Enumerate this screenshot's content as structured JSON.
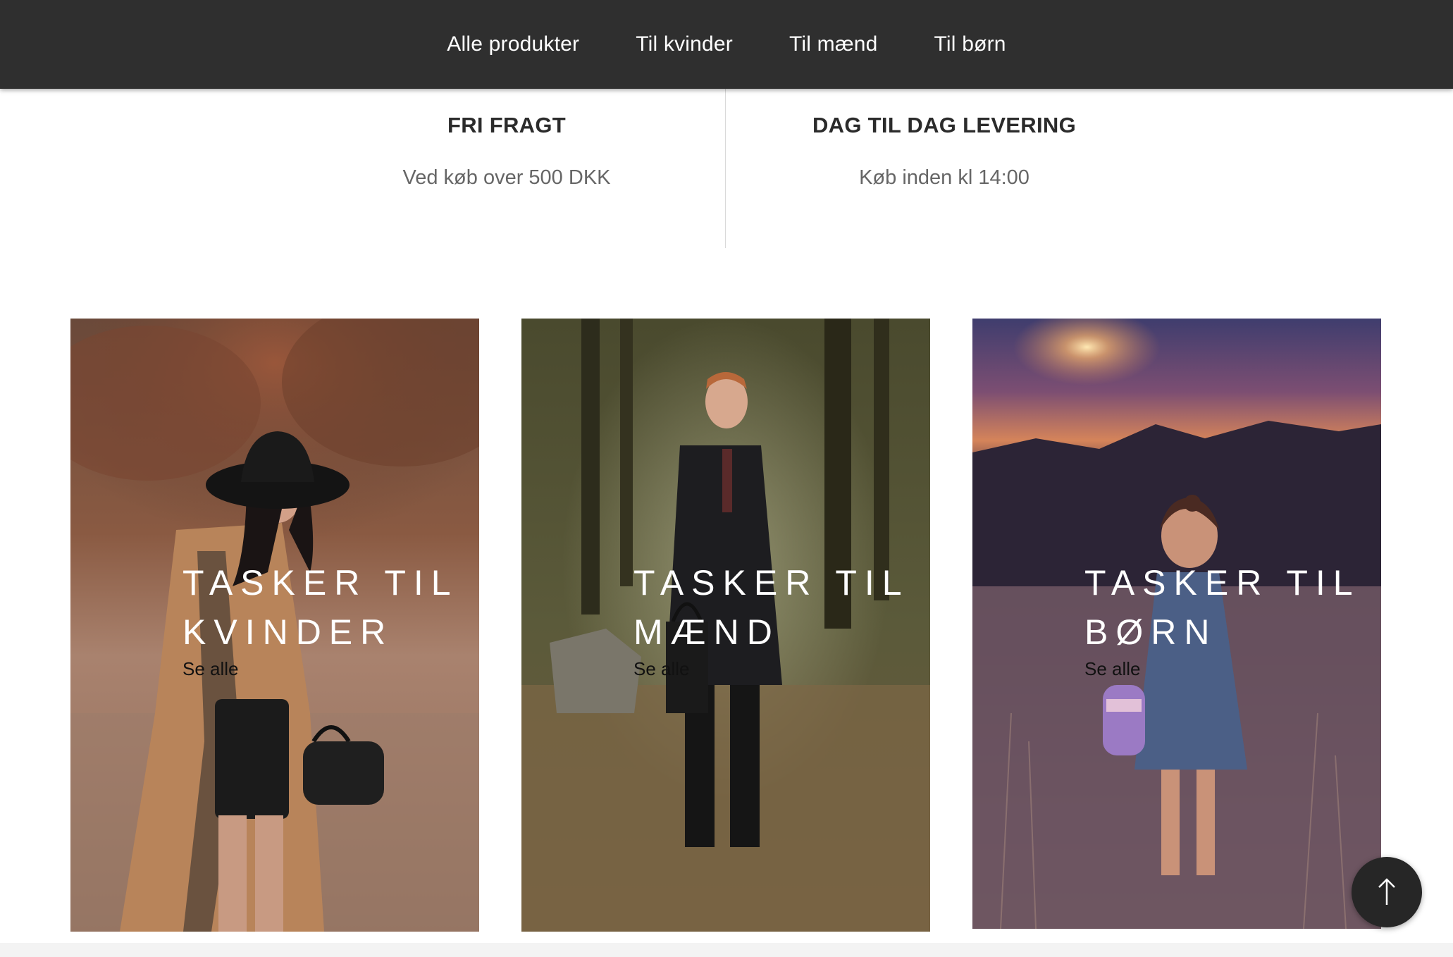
{
  "nav": {
    "items": [
      {
        "label": "Alle produkter"
      },
      {
        "label": "Til kvinder"
      },
      {
        "label": "Til mænd"
      },
      {
        "label": "Til børn"
      }
    ]
  },
  "features": [
    {
      "title": "FRI FRAGT",
      "subtitle": "Ved køb over 500 DKK"
    },
    {
      "title": "DAG TIL DAG LEVERING",
      "subtitle": "Køb inden kl 14:00"
    }
  ],
  "categories": [
    {
      "title": "TASKER TIL\nKVINDER",
      "link": "Se alle"
    },
    {
      "title": "TASKER TIL\nMÆND",
      "link": "Se alle"
    },
    {
      "title": "TASKER TIL\nBØRN",
      "link": "Se alle"
    }
  ],
  "back_to_top": {
    "icon": "arrow-up-icon"
  },
  "colors": {
    "nav_bg": "#2f2f2f",
    "nav_text": "#ffffff",
    "button_bg": "#262626"
  }
}
